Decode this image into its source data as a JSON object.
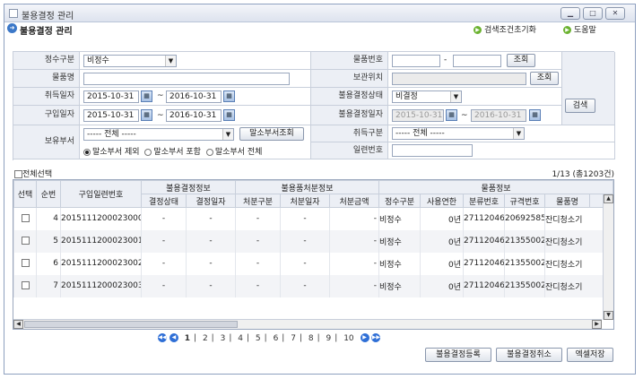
{
  "window": {
    "title": "불용결정 관리"
  },
  "page": {
    "title": "불용결정 관리",
    "reset_label": "검색조건초기화",
    "help_label": "도움말"
  },
  "form": {
    "acct_type_label": "정수구분",
    "acct_type_value": "비정수",
    "item_no_label": "물품번호",
    "item_no_sep": "-",
    "item_no_btn": "조회",
    "item_name_label": "물품명",
    "storage_label": "보관위치",
    "storage_btn": "조회",
    "acq_date_label": "취득일자",
    "acq_from": "2015-10-31",
    "acq_to": "2016-10-31",
    "decision_status_label": "불용결정상태",
    "decision_status_value": "비결정",
    "purchase_date_label": "구입일자",
    "pur_from": "2015-10-31",
    "pur_to": "2016-10-31",
    "decision_date_label": "불용결정일자",
    "dec_from": "2015-10-31",
    "dec_to": "2016-10-31",
    "owner_dept_label": "보유부서",
    "owner_dept_value": "----- 전체 -----",
    "erased_dept_btn": "말소부서조회",
    "acq_type_label": "취득구분",
    "acq_type_value": "----- 전체 -----",
    "serial_label": "일련번호",
    "radio_exclude": "말소부서 제외",
    "radio_include": "말소부서 포함",
    "radio_all": "말소부서 전체",
    "tilde": "~",
    "search_btn": "검색"
  },
  "list": {
    "select_all": "전체선택",
    "count_text": "1/13 (총1203건)"
  },
  "table": {
    "headers": {
      "select": "선택",
      "seq": "순번",
      "serial": "구입일련번호",
      "decision_group": "불용결정정보",
      "decision_status": "결정상태",
      "decision_date": "결정일자",
      "disposal_group": "불용품처분정보",
      "disposal_type": "처분구분",
      "disposal_date": "처분일자",
      "disposal_amount": "처분금액",
      "item_group": "물품정보",
      "acct_type": "정수구분",
      "useful_life": "사용연한",
      "class_no": "분류번호",
      "spec_no": "규격번호",
      "item_name": "물품명"
    },
    "rows": [
      {
        "seq": "4",
        "serial": "2015111200023000",
        "dstatus": "-",
        "ddate": "-",
        "ptype": "-",
        "pdate": "-",
        "pamount": "-",
        "acct": "비정수",
        "life": "0년",
        "class": "27112046",
        "spec": "20692585",
        "name": "잔디청소기"
      },
      {
        "seq": "5",
        "serial": "2015111200023001",
        "dstatus": "-",
        "ddate": "-",
        "ptype": "-",
        "pdate": "-",
        "pamount": "-",
        "acct": "비정수",
        "life": "0년",
        "class": "27112046",
        "spec": "21355002",
        "name": "잔디청소기"
      },
      {
        "seq": "6",
        "serial": "2015111200023002",
        "dstatus": "-",
        "ddate": "-",
        "ptype": "-",
        "pdate": "-",
        "pamount": "-",
        "acct": "비정수",
        "life": "0년",
        "class": "27112046",
        "spec": "21355002",
        "name": "잔디청소기"
      },
      {
        "seq": "7",
        "serial": "2015111200023003",
        "dstatus": "-",
        "ddate": "-",
        "ptype": "-",
        "pdate": "-",
        "pamount": "-",
        "acct": "비정수",
        "life": "0년",
        "class": "27112046",
        "spec": "21355002",
        "name": "잔디청소기"
      }
    ]
  },
  "pager": {
    "pages": [
      "1",
      "2",
      "3",
      "4",
      "5",
      "6",
      "7",
      "8",
      "9",
      "10"
    ],
    "sep": "|"
  },
  "actions": {
    "register": "불용결정등록",
    "cancel": "불용결정취소",
    "excel": "엑셀저장"
  }
}
